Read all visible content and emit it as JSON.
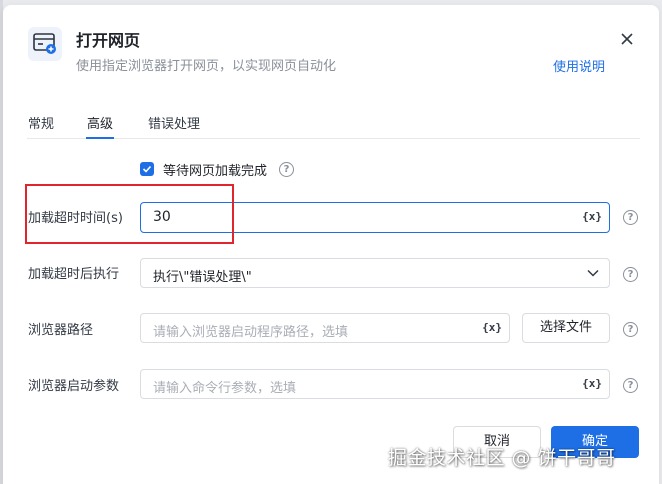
{
  "dialog": {
    "title": "打开网页",
    "subtitle": "使用指定浏览器打开网页，以实现网页自动化",
    "help_link": "使用说明"
  },
  "tabs": [
    {
      "label": "常规"
    },
    {
      "label": "高级"
    },
    {
      "label": "错误处理"
    }
  ],
  "active_tab": "高级",
  "form": {
    "wait_checkbox": {
      "label": "等待网页加载完成",
      "checked": true
    },
    "timeout": {
      "label": "加载超时时间(s)",
      "value": "30"
    },
    "after_timeout": {
      "label": "加载超时后执行",
      "value": "执行\\\"错误处理\\\""
    },
    "browser_path": {
      "label": "浏览器路径",
      "placeholder": "请输入浏览器启动程序路径，选填",
      "button": "选择文件"
    },
    "launch_params": {
      "label": "浏览器启动参数",
      "placeholder": "请输入命令行参数，选填"
    }
  },
  "var_icon_text": "{x}",
  "help_icon_text": "?",
  "footer": {
    "cancel": "取消",
    "ok": "确定"
  },
  "watermark": "掘金技术社区 @ 饼干哥哥",
  "colors": {
    "accent": "#1e6fe6",
    "highlight": "#e0262d"
  }
}
